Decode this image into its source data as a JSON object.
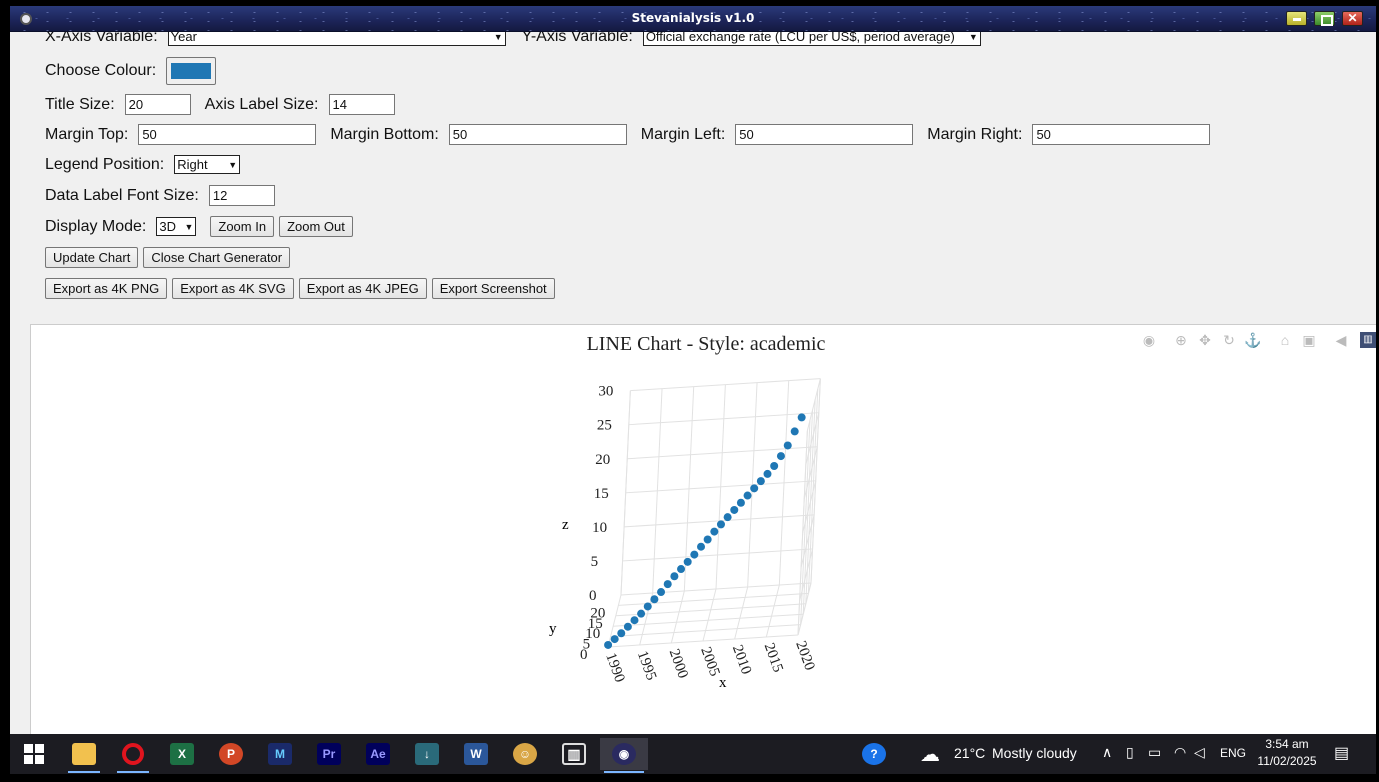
{
  "window": {
    "title": "Stevanialysis v1.0"
  },
  "controls": {
    "x_axis_label": "X-Axis Variable:",
    "x_axis_value": "Year",
    "y_axis_label": "Y-Axis Variable:",
    "y_axis_value": "Official exchange rate (LCU per US$, period average)",
    "colour_label": "Choose Colour:",
    "colour_value": "#1f77b4",
    "title_size_label": "Title Size:",
    "title_size_value": "20",
    "axis_label_size_label": "Axis Label Size:",
    "axis_label_size_value": "14",
    "margin_top_label": "Margin Top:",
    "margin_top_value": "50",
    "margin_bottom_label": "Margin Bottom:",
    "margin_bottom_value": "50",
    "margin_left_label": "Margin Left:",
    "margin_left_value": "50",
    "margin_right_label": "Margin Right:",
    "margin_right_value": "50",
    "legend_position_label": "Legend Position:",
    "legend_position_value": "Right",
    "data_label_font_label": "Data Label Font Size:",
    "data_label_font_value": "12",
    "display_mode_label": "Display Mode:",
    "display_mode_value": "3D",
    "zoom_in": "Zoom In",
    "zoom_out": "Zoom Out",
    "update_chart": "Update Chart",
    "close_generator": "Close Chart Generator",
    "export_png": "Export as 4K PNG",
    "export_svg": "Export as 4K SVG",
    "export_jpeg": "Export as 4K JPEG",
    "export_screenshot": "Export Screenshot"
  },
  "modebar_icons": [
    "camera-icon",
    "zoom-icon",
    "pan-icon",
    "orbit-rotation-icon",
    "turntable-rotation-icon",
    "reset-camera-icon",
    "last-saved-camera-icon",
    "hover-toggle-icon",
    "plotly-logo-icon"
  ],
  "chart_data": {
    "type": "scatter",
    "mode": "3d",
    "title": "LINE Chart - Style: academic",
    "xlabel": "x",
    "ylabel": "y",
    "zlabel": "z",
    "x_ticks": [
      "1990",
      "1995",
      "2000",
      "2005",
      "2010",
      "2015",
      "2020"
    ],
    "y_ticks": [
      "0",
      "5",
      "10",
      "15",
      "20"
    ],
    "z_ticks": [
      "0",
      "5",
      "10",
      "15",
      "20",
      "25",
      "30"
    ],
    "xlim": [
      1990,
      2020
    ],
    "zlim": [
      0,
      32
    ],
    "marker_color": "#1f77b4",
    "x": [
      1990,
      1991,
      1992,
      1993,
      1994,
      1995,
      1996,
      1997,
      1998,
      1999,
      2000,
      2001,
      2002,
      2003,
      2004,
      2005,
      2006,
      2007,
      2008,
      2009,
      2010,
      2011,
      2012,
      2013,
      2014,
      2015,
      2016,
      2017,
      2018,
      2019
    ],
    "z": [
      0.3,
      1.1,
      1.9,
      2.8,
      3.7,
      4.6,
      5.6,
      6.6,
      7.6,
      8.7,
      9.8,
      10.8,
      11.8,
      12.8,
      13.9,
      14.9,
      16.0,
      17.0,
      18.0,
      19.0,
      20.0,
      21.0,
      22.0,
      23.0,
      24.0,
      25.1,
      26.5,
      28.0,
      30.0,
      32.0
    ]
  },
  "taskbar": {
    "apps": [
      "windows-start-icon",
      "file-explorer-icon",
      "opera-icon",
      "excel-icon",
      "powerpoint-icon",
      "app-m-icon",
      "premiere-pro-icon",
      "after-effects-icon",
      "app-arrow-icon",
      "word-icon",
      "game-icon",
      "library-icon",
      "stevanialysis-icon"
    ],
    "weather_temp": "21°C",
    "weather_desc": "Mostly cloudy",
    "language": "ENG",
    "time": "3:54 am",
    "date": "11/02/2025"
  }
}
